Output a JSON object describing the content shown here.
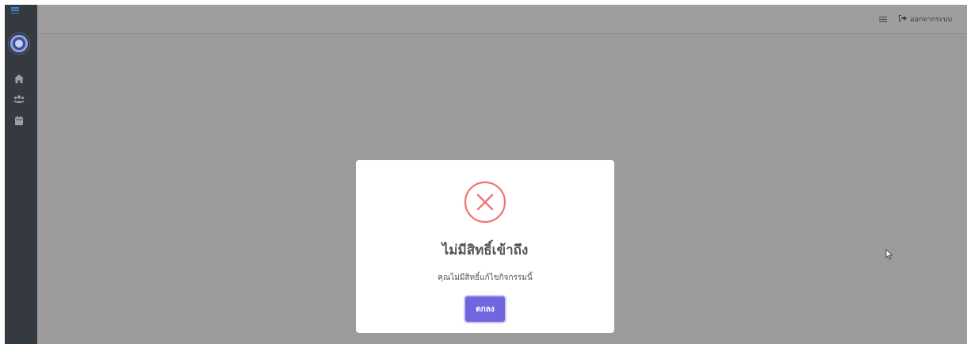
{
  "header": {
    "logout_label": "ออกจากระบบ",
    "logout_icon": "sign-out-icon",
    "menu_icon": "hamburger-icon"
  },
  "sidebar": {
    "toggle_icon": "hamburger-icon",
    "logo": "logo",
    "items": [
      {
        "icon": "home-icon"
      },
      {
        "icon": "users-icon"
      },
      {
        "icon": "calendar-icon"
      }
    ]
  },
  "dialog": {
    "icon": "error-x-icon",
    "title": "ไม่มีสิทธิ์เข้าถึง",
    "message": "คุณไม่มีสิทธิ์แก้ไขกิจกรรมนี้",
    "confirm_label": "ตกลง"
  },
  "colors": {
    "sidebar_bg": "#343a40",
    "overlay_bg": "#9b9b9b",
    "error_red": "#f27474",
    "confirm_button": "#7066e0"
  }
}
